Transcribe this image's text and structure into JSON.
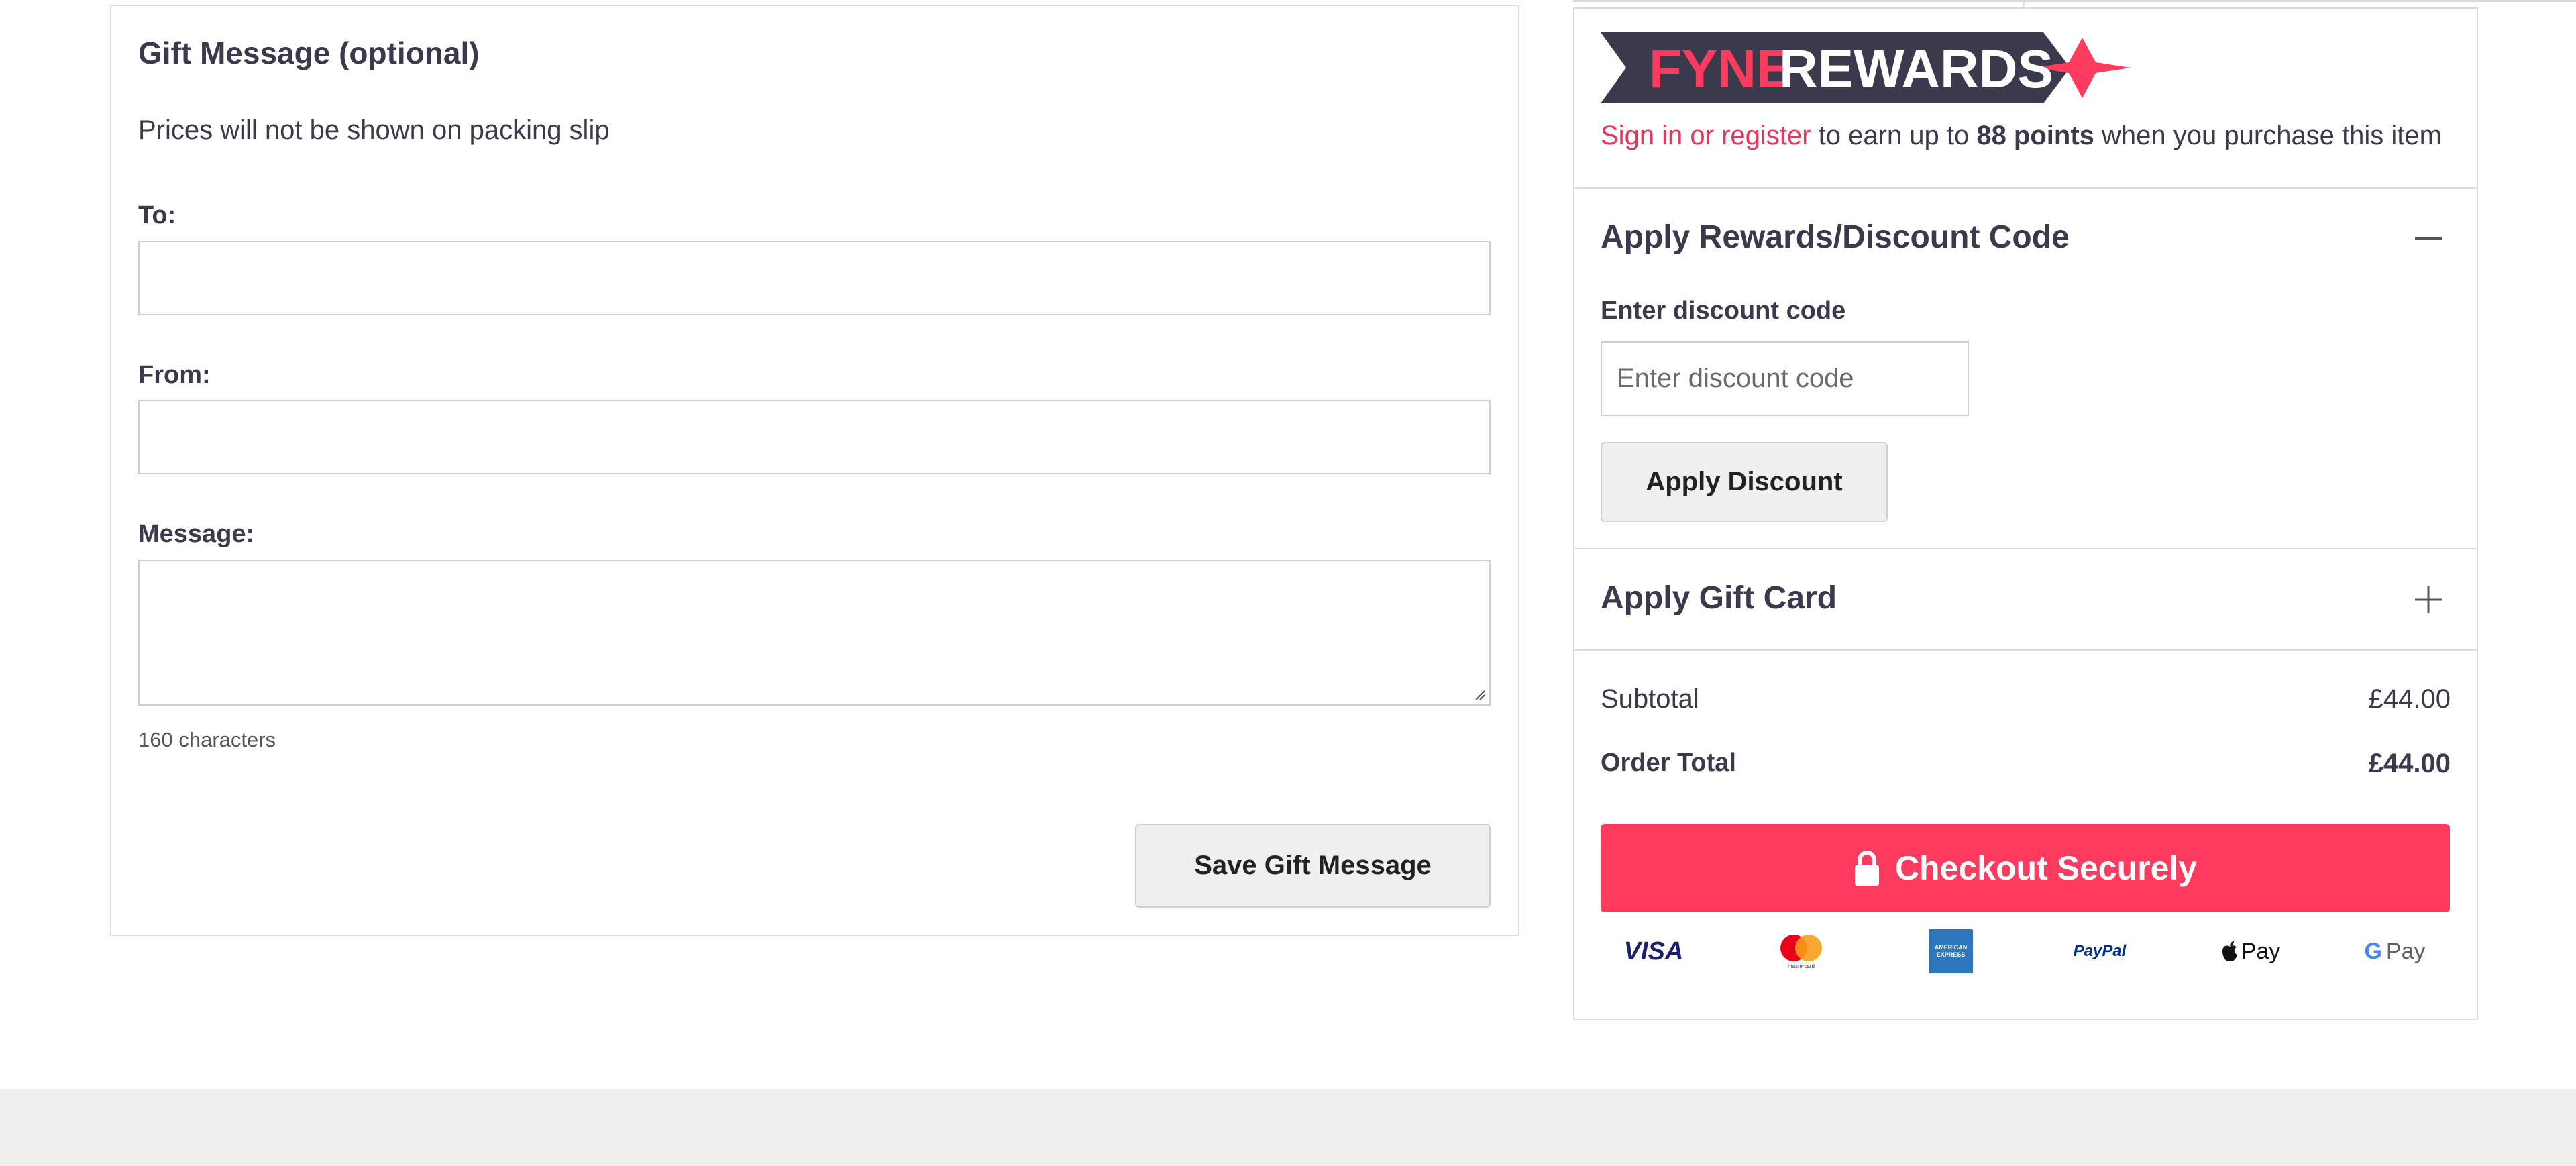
{
  "gift": {
    "title": "Gift Message (optional)",
    "subtitle": "Prices will not be shown on packing slip",
    "to_label": "To:",
    "to_value": "",
    "from_label": "From:",
    "from_value": "",
    "message_label": "Message:",
    "message_value": "",
    "char_count": "160 characters",
    "save_label": "Save Gift Message"
  },
  "rewards": {
    "logo_text_left": "FYNE",
    "logo_text_right": "REWARDS",
    "link": "Sign in or register",
    "text_before_points": " to earn up to ",
    "points": "88 points",
    "text_after_points": " when you purchase this item"
  },
  "discount": {
    "title": "Apply Rewards/Discount Code",
    "label": "Enter discount code",
    "placeholder": "Enter discount code",
    "button": "Apply Discount",
    "toggle_icon": "minus-icon"
  },
  "gift_card": {
    "title": "Apply Gift Card",
    "toggle_icon": "plus-icon"
  },
  "totals": {
    "subtotal_label": "Subtotal",
    "subtotal_value": "£44.00",
    "total_label": "Order Total",
    "total_value": "£44.00"
  },
  "checkout": {
    "label": "Checkout Securely",
    "icon": "lock-icon"
  },
  "payment_methods": {
    "visa": "VISA",
    "mastercard_caption": "mastercard",
    "amex_caption": "AMERICAN EXPRESS",
    "paypal": "PayPal",
    "apple_pay": "Pay",
    "google_pay": "Pay",
    "google_g": "G"
  },
  "colors": {
    "accent": "#fd3b5f",
    "link": "#e8355a",
    "text": "#3b3a4d",
    "footer": "#efeeec"
  }
}
